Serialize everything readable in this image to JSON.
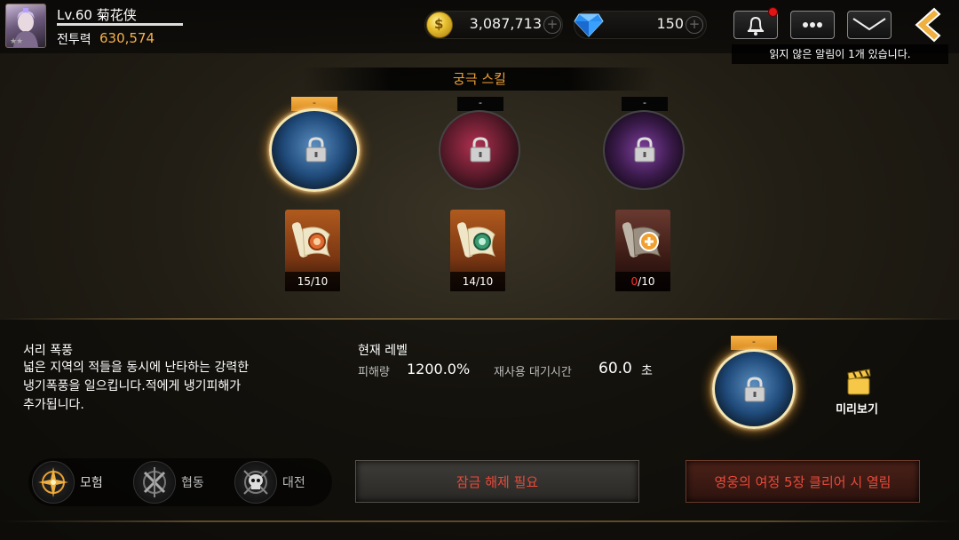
{
  "player": {
    "level": "Lv.60",
    "name": "菊花侠",
    "power_label": "전투력",
    "power_value": "630,574",
    "rank_stars": "★★"
  },
  "currency": {
    "gold": "3,087,713",
    "gems": "150",
    "gold_symbol": "$",
    "plus_symbol": "+"
  },
  "header": {
    "notification": "읽지 않은 알림이 1개 있습니다."
  },
  "title": "궁극 스킬",
  "skills": [
    {
      "tag": "-",
      "state": "locked",
      "selected": true,
      "color": "#1f4a7a"
    },
    {
      "tag": "-",
      "state": "locked",
      "selected": false,
      "color": "#5a1a2a"
    },
    {
      "tag": "-",
      "state": "locked",
      "selected": false,
      "color": "#3a1a4a"
    }
  ],
  "scrolls": [
    {
      "have": "15",
      "sep": "/",
      "need": "10"
    },
    {
      "have": "14",
      "sep": "/",
      "need": "10"
    },
    {
      "have": "0",
      "sep": "/",
      "need": "10"
    }
  ],
  "detail": {
    "name": "서리 폭풍",
    "desc_line1": "넓은 지역의 적들을 동시에 난타하는 강력한",
    "desc_line2": "냉기폭풍을 일으킵니다.적에게 냉기피해가",
    "desc_line3": "추가됩니다.",
    "current_level_label": "현재 레벨",
    "damage_label": "피해량",
    "damage_value": "1200.0%",
    "cooldown_label": "재사용 대기시간",
    "cooldown_value": "60.0",
    "cooldown_unit": "초",
    "tag": "-",
    "preview_label": "미리보기"
  },
  "modes": [
    {
      "label": "모험",
      "active": true
    },
    {
      "label": "협동",
      "active": false
    },
    {
      "label": "대전",
      "active": false
    }
  ],
  "buttons": {
    "unlock": "잠금 해제 필요",
    "open_condition": "영웅의 여정 5장 클리어 시 열림"
  },
  "colors": {
    "accent_gold": "#f5b14a",
    "title_orange": "#f0a23a",
    "warning_red": "#e84a3a"
  }
}
